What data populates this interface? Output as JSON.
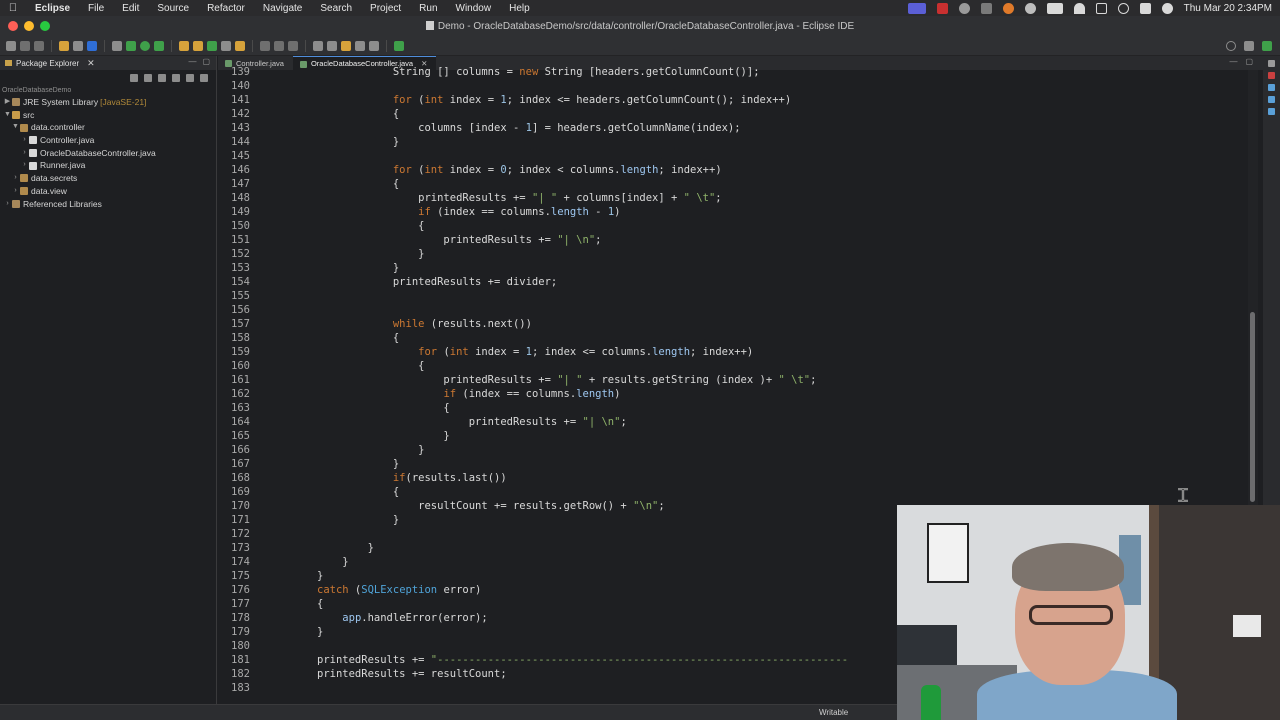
{
  "menubar": {
    "items": [
      "Eclipse",
      "File",
      "Edit",
      "Source",
      "Refactor",
      "Navigate",
      "Search",
      "Project",
      "Run",
      "Window",
      "Help"
    ],
    "clock": "Thu Mar 20  2:34PM"
  },
  "window": {
    "title": "Demo - OracleDatabaseDemo/src/data/controller/OracleDatabaseController.java - Eclipse IDE"
  },
  "package_explorer": {
    "tab_label": "Package Explorer",
    "project": "OracleDatabaseDemo",
    "tree": [
      {
        "label": "JRE System Library",
        "suffix": "[JavaSE-21]"
      },
      {
        "label": "src"
      },
      {
        "label": "data.controller"
      },
      {
        "label": "Controller.java"
      },
      {
        "label": "OracleDatabaseController.java"
      },
      {
        "label": "Runner.java"
      },
      {
        "label": "data.secrets"
      },
      {
        "label": "data.view"
      },
      {
        "label": "Referenced Libraries"
      }
    ]
  },
  "editor": {
    "tabs": [
      {
        "label": "Controller.java"
      },
      {
        "label": "OracleDatabaseController.java"
      }
    ],
    "line_numbers": [
      "139",
      "140",
      "141",
      "142",
      "143",
      "144",
      "145",
      "146",
      "147",
      "148",
      "149",
      "150",
      "151",
      "152",
      "153",
      "154",
      "155",
      "156",
      "157",
      "158",
      "159",
      "160",
      "161",
      "162",
      "163",
      "164",
      "165",
      "166",
      "167",
      "168",
      "169",
      "170",
      "171",
      "172",
      "173",
      "174",
      "175",
      "176",
      "177",
      "178",
      "179",
      "180",
      "181",
      "182",
      "183"
    ]
  },
  "statusbar": {
    "writable": "Writable"
  },
  "colors": {
    "keyword": "#cc7832",
    "string": "#8fb36a",
    "number": "#9cc4e4",
    "class": "#4fa3d8",
    "active_tab_accent": "#4f8ddb"
  }
}
